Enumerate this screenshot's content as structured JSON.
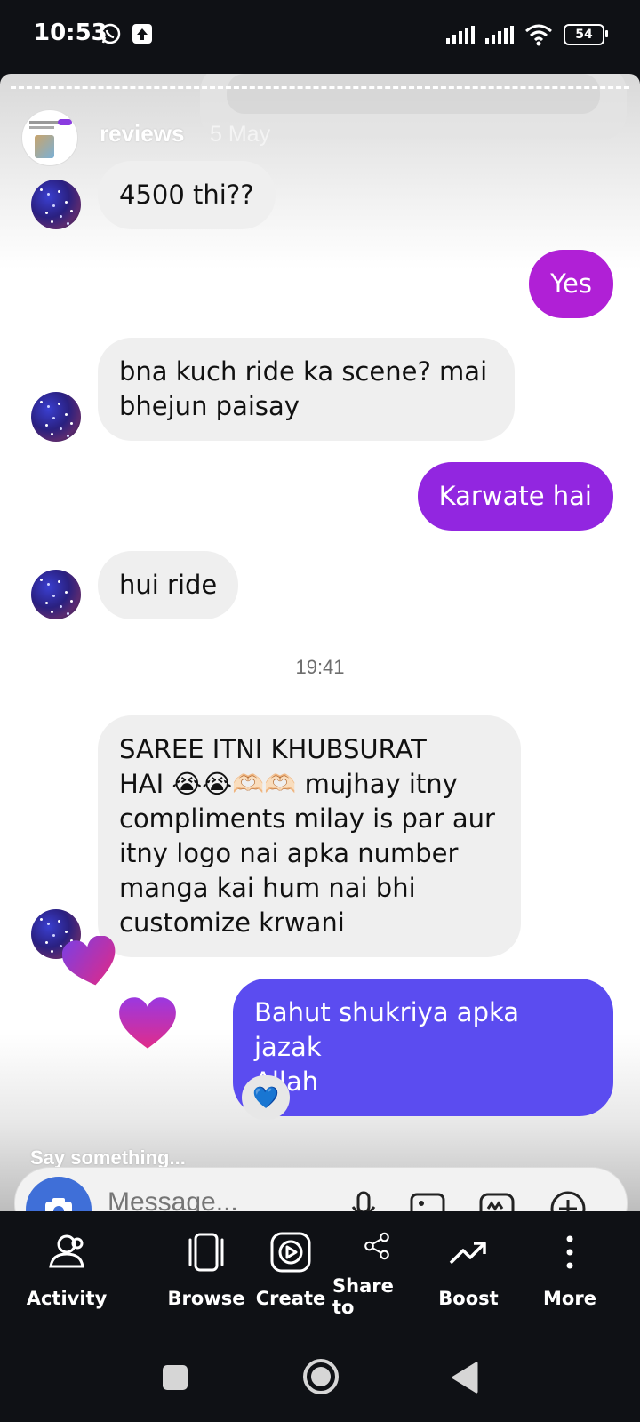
{
  "status_bar": {
    "time": "10:53",
    "battery": "54"
  },
  "story": {
    "account_name": "reviews",
    "date": "5 May"
  },
  "messages": [
    {
      "direction": "in",
      "text": "4500 thi??"
    },
    {
      "direction": "out",
      "text": "Yes"
    },
    {
      "direction": "in",
      "text": "bna kuch ride ka scene? mai\nbhejun paisay"
    },
    {
      "direction": "out",
      "text": "Karwate hai"
    },
    {
      "direction": "in",
      "text": "hui ride"
    },
    {
      "direction": "in",
      "text": "SAREE ITNI KHUBSURAT\nHAI 😭😭🫶🏻🫶🏻 mujhay itny\ncompliments milay is par aur\nitny logo nai apka number\nmanga kai hum nai bhi\ncustomize krwani"
    },
    {
      "direction": "out",
      "text": "Bahut shukriya apka jazak\nAllah"
    }
  ],
  "timestamp": "19:41",
  "reaction": "💙",
  "reply": {
    "prompt": "Say something...",
    "placeholder": "Message..."
  },
  "actions": [
    {
      "label": "Activity",
      "icon": "activity-icon"
    },
    {
      "label": "Browse",
      "icon": "browse-icon"
    },
    {
      "label": "Create",
      "icon": "create-icon"
    },
    {
      "label": "Share to",
      "icon": "share-icon"
    },
    {
      "label": "Boost",
      "icon": "boost-icon"
    },
    {
      "label": "More",
      "icon": "more-icon"
    }
  ],
  "colors": {
    "bubble_in": "#efefef",
    "bubble_out_top": "#a41fd8",
    "bubble_out_bottom": "#5b4ff0",
    "heart": "#d62f9c"
  }
}
